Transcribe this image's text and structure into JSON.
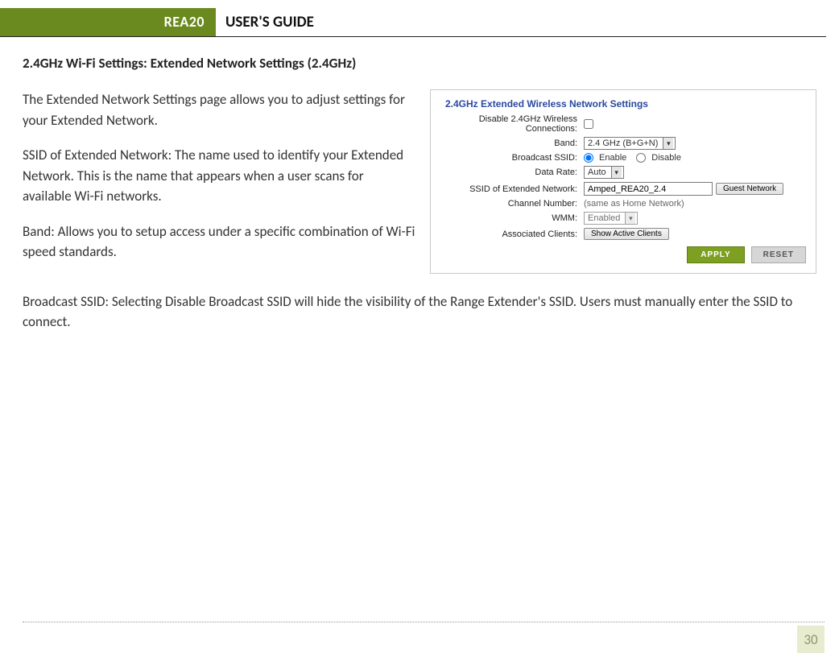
{
  "header": {
    "badge": "REA20",
    "title": "USER'S GUIDE"
  },
  "section_title": "2.4GHz Wi-Fi Settings: Extended Network Settings (2.4GHz)",
  "paragraphs": {
    "p1": "The Extended Network Settings page allows you to adjust settings for your Extended Network.",
    "p2": "SSID of Extended Network: The name used to identify your Extended Network. This is the name that appears when a user scans for available Wi-Fi networks.",
    "p3": "Band: Allows you to setup access under a specific combination of Wi-Fi speed standards.",
    "p4": "Broadcast SSID: Selecting Disable Broadcast SSID will hide the visibility of the Range Extender's SSID. Users must manually enter the SSID to connect."
  },
  "panel": {
    "title": "2.4GHz Extended Wireless Network Settings",
    "rows": {
      "disable_label": "Disable 2.4GHz Wireless Connections:",
      "band_label": "Band:",
      "band_value": "2.4 GHz (B+G+N)",
      "broadcast_label": "Broadcast SSID:",
      "broadcast_enable": "Enable",
      "broadcast_disable": "Disable",
      "datarate_label": "Data Rate:",
      "datarate_value": "Auto",
      "ssid_label": "SSID of Extended Network:",
      "ssid_value": "Amped_REA20_2.4",
      "guest_button": "Guest Network",
      "channel_label": "Channel Number:",
      "channel_value": "(same as Home Network)",
      "wmm_label": "WMM:",
      "wmm_value": "Enabled",
      "clients_label": "Associated Clients:",
      "clients_button": "Show Active Clients"
    },
    "apply": "APPLY",
    "reset": "RESET"
  },
  "page_number": "30"
}
